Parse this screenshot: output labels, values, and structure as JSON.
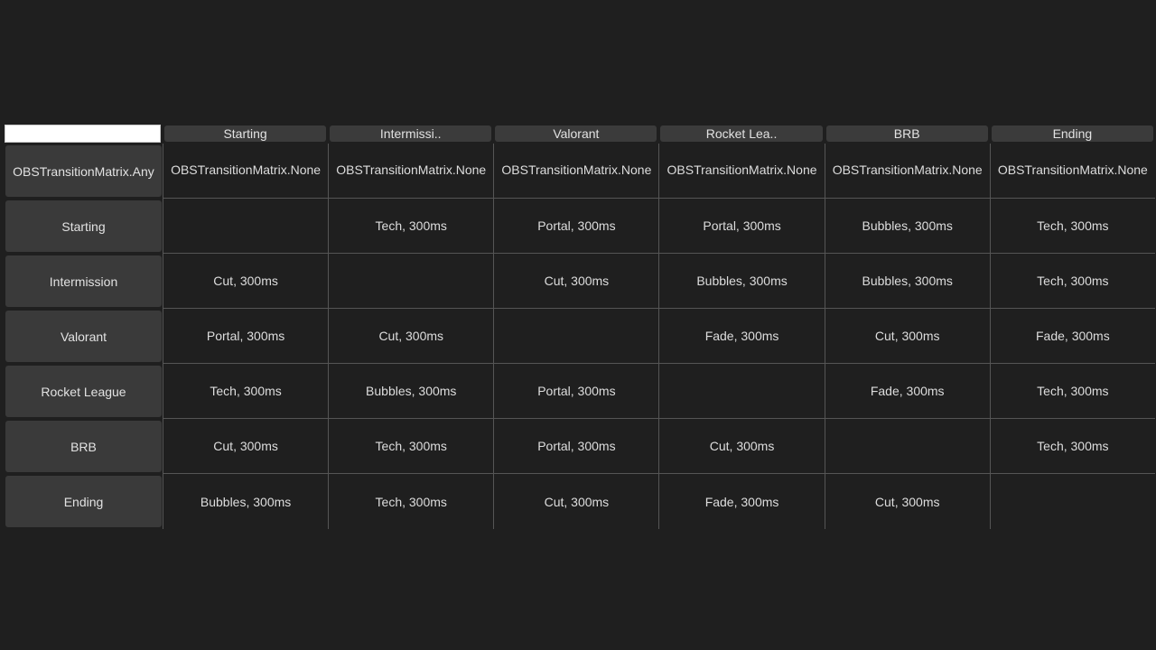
{
  "corner_input": {
    "value": ""
  },
  "columns": [
    "Starting",
    "Intermissi..",
    "Valorant",
    "Rocket Lea..",
    "BRB",
    "Ending"
  ],
  "rows": [
    {
      "label": "OBSTransitionMatrix.Any",
      "cells": [
        "OBSTransitionMatrix.None",
        "OBSTransitionMatrix.None",
        "OBSTransitionMatrix.None",
        "OBSTransitionMatrix.None",
        "OBSTransitionMatrix.None",
        "OBSTransitionMatrix.None"
      ]
    },
    {
      "label": "Starting",
      "cells": [
        "",
        "Tech, 300ms",
        "Portal, 300ms",
        "Portal, 300ms",
        "Bubbles, 300ms",
        "Tech, 300ms"
      ]
    },
    {
      "label": "Intermission",
      "cells": [
        "Cut, 300ms",
        "",
        "Cut, 300ms",
        "Bubbles, 300ms",
        "Bubbles, 300ms",
        "Tech, 300ms"
      ]
    },
    {
      "label": "Valorant",
      "cells": [
        "Portal, 300ms",
        "Cut, 300ms",
        "",
        "Fade, 300ms",
        "Cut, 300ms",
        "Fade, 300ms"
      ]
    },
    {
      "label": "Rocket League",
      "cells": [
        "Tech, 300ms",
        "Bubbles, 300ms",
        "Portal, 300ms",
        "",
        "Fade, 300ms",
        "Tech, 300ms"
      ]
    },
    {
      "label": "BRB",
      "cells": [
        "Cut, 300ms",
        "Tech, 300ms",
        "Portal, 300ms",
        "Cut, 300ms",
        "",
        "Tech, 300ms"
      ]
    },
    {
      "label": "Ending",
      "cells": [
        "Bubbles, 300ms",
        "Tech, 300ms",
        "Cut, 300ms",
        "Fade, 300ms",
        "Cut, 300ms",
        ""
      ]
    }
  ]
}
